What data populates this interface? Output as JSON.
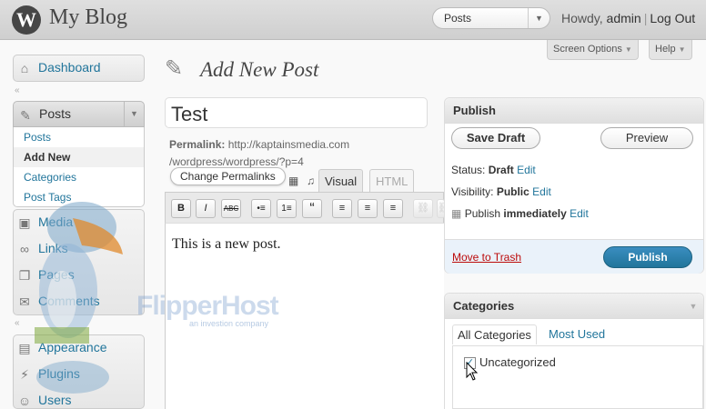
{
  "header": {
    "site_title": "My Blog",
    "favorite_action": "Posts",
    "howdy_prefix": "Howdy,",
    "user": "admin",
    "logout": "Log Out"
  },
  "screen_meta": {
    "options_label": "Screen Options",
    "help_label": "Help"
  },
  "sidebar": {
    "dashboard": "Dashboard",
    "posts": "Posts",
    "posts_submenu": [
      "Posts",
      "Add New",
      "Categories",
      "Post Tags"
    ],
    "items": [
      "Media",
      "Links",
      "Pages",
      "Comments"
    ],
    "items2": [
      "Appearance",
      "Plugins",
      "Users"
    ]
  },
  "page": {
    "title": "Add New Post"
  },
  "editor": {
    "post_title": "Test",
    "permalink_label": "Permalink:",
    "permalink_url": "http://kaptainsmedia.com /wordpress/wordpress/?p=4",
    "change_permalinks": "Change Permalinks",
    "tab_visual": "Visual",
    "tab_html": "HTML",
    "content": "This is a new post.",
    "toolbar": [
      "B",
      "I",
      "ABC",
      "•≡",
      "1≡",
      "“",
      "≡",
      "≡",
      "≡",
      "⛓",
      "⛓"
    ]
  },
  "watermark": {
    "brand": "FlipperHost",
    "tagline": "an investion company"
  },
  "publish": {
    "title": "Publish",
    "save_draft": "Save Draft",
    "preview": "Preview",
    "status_label": "Status:",
    "status_value": "Draft",
    "visibility_label": "Visibility:",
    "visibility_value": "Public",
    "publish_label": "Publish",
    "publish_when": "immediately",
    "edit": "Edit",
    "move_to_trash": "Move to Trash",
    "publish_button": "Publish"
  },
  "categories": {
    "title": "Categories",
    "tab_all": "All Categories",
    "tab_most_used": "Most Used",
    "items": [
      {
        "label": "Uncategorized",
        "checked": true
      }
    ]
  },
  "colors": {
    "accent": "#21759b",
    "trash": "#bc0b0b",
    "publish_button": "#21759b"
  }
}
